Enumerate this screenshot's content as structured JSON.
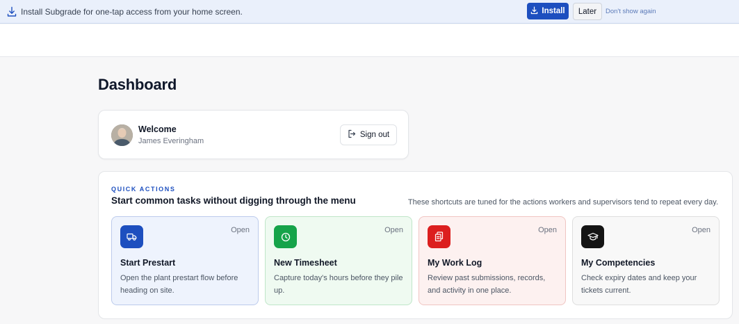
{
  "banner": {
    "message": "Install Subgrade for one-tap access from your home screen.",
    "install_label": "Install",
    "later_label": "Later",
    "dismiss_label": "Don't show again"
  },
  "page": {
    "title": "Dashboard"
  },
  "welcome": {
    "title": "Welcome",
    "name": "James Everingham",
    "signout_label": "Sign out"
  },
  "quick_actions": {
    "eyebrow": "QUICK ACTIONS",
    "heading": "Start common tasks without digging through the menu",
    "note": "These shortcuts are tuned for the actions workers and supervisors tend to repeat every day.",
    "items": [
      {
        "title": "Start Prestart",
        "desc": "Open the plant prestart flow before heading on site.",
        "open": "Open",
        "icon": "truck-icon",
        "accent": "#1d4fbf",
        "bg": "#eef3fd",
        "border": "#bccbec"
      },
      {
        "title": "New Timesheet",
        "desc": "Capture today's hours before they pile up.",
        "open": "Open",
        "icon": "clock-icon",
        "accent": "#16a34a",
        "bg": "#effaf1",
        "border": "#bfe6c8"
      },
      {
        "title": "My Work Log",
        "desc": "Review past submissions, records, and activity in one place.",
        "open": "Open",
        "icon": "documents-icon",
        "accent": "#dc1f1f",
        "bg": "#fdf1f0",
        "border": "#f0c5c2"
      },
      {
        "title": "My Competencies",
        "desc": "Check expiry dates and keep your tickets current.",
        "open": "Open",
        "icon": "graduation-cap-icon",
        "accent": "#141414",
        "bg": "#f8f8f8",
        "border": "#dedede"
      }
    ]
  }
}
